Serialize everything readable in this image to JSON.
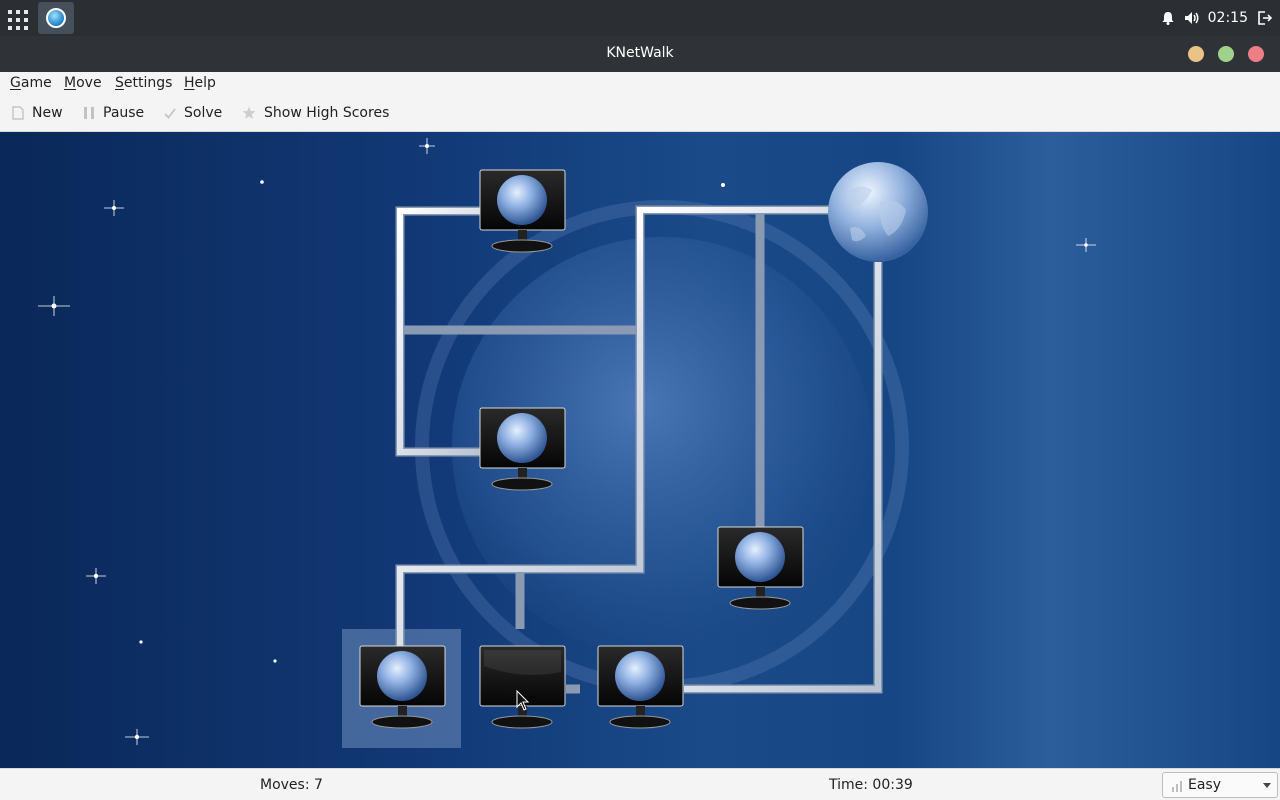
{
  "system_panel": {
    "clock": "02:15",
    "icons": [
      "app-launcher-icon",
      "knetwalk-task-icon",
      "bell-icon",
      "volume-icon",
      "logout-icon"
    ]
  },
  "window": {
    "title": "KNetWalk",
    "buttons": [
      "minimize",
      "maximize",
      "close"
    ],
    "button_colors": {
      "minimize": "#e9c487",
      "maximize": "#9fd28a",
      "close": "#eb7f84"
    }
  },
  "menu": {
    "game": "Game",
    "move": "Move",
    "settings": "Settings",
    "help": "Help"
  },
  "toolbar": {
    "new": "New",
    "pause": "Pause",
    "solve": "Solve",
    "high_scores": "Show High Scores"
  },
  "game": {
    "server_icon": "globe-server-icon",
    "terminals": [
      {
        "name": "terminal-top",
        "connected": true
      },
      {
        "name": "terminal-middle-left",
        "connected": true
      },
      {
        "name": "terminal-right",
        "connected": true
      },
      {
        "name": "terminal-bottom-left",
        "connected": true,
        "selected": true
      },
      {
        "name": "terminal-bottom-middle",
        "connected": false
      },
      {
        "name": "terminal-bottom-right",
        "connected": true
      }
    ]
  },
  "status": {
    "moves": "Moves: 7",
    "time": "Time: 00:39",
    "difficulty": "Easy"
  }
}
